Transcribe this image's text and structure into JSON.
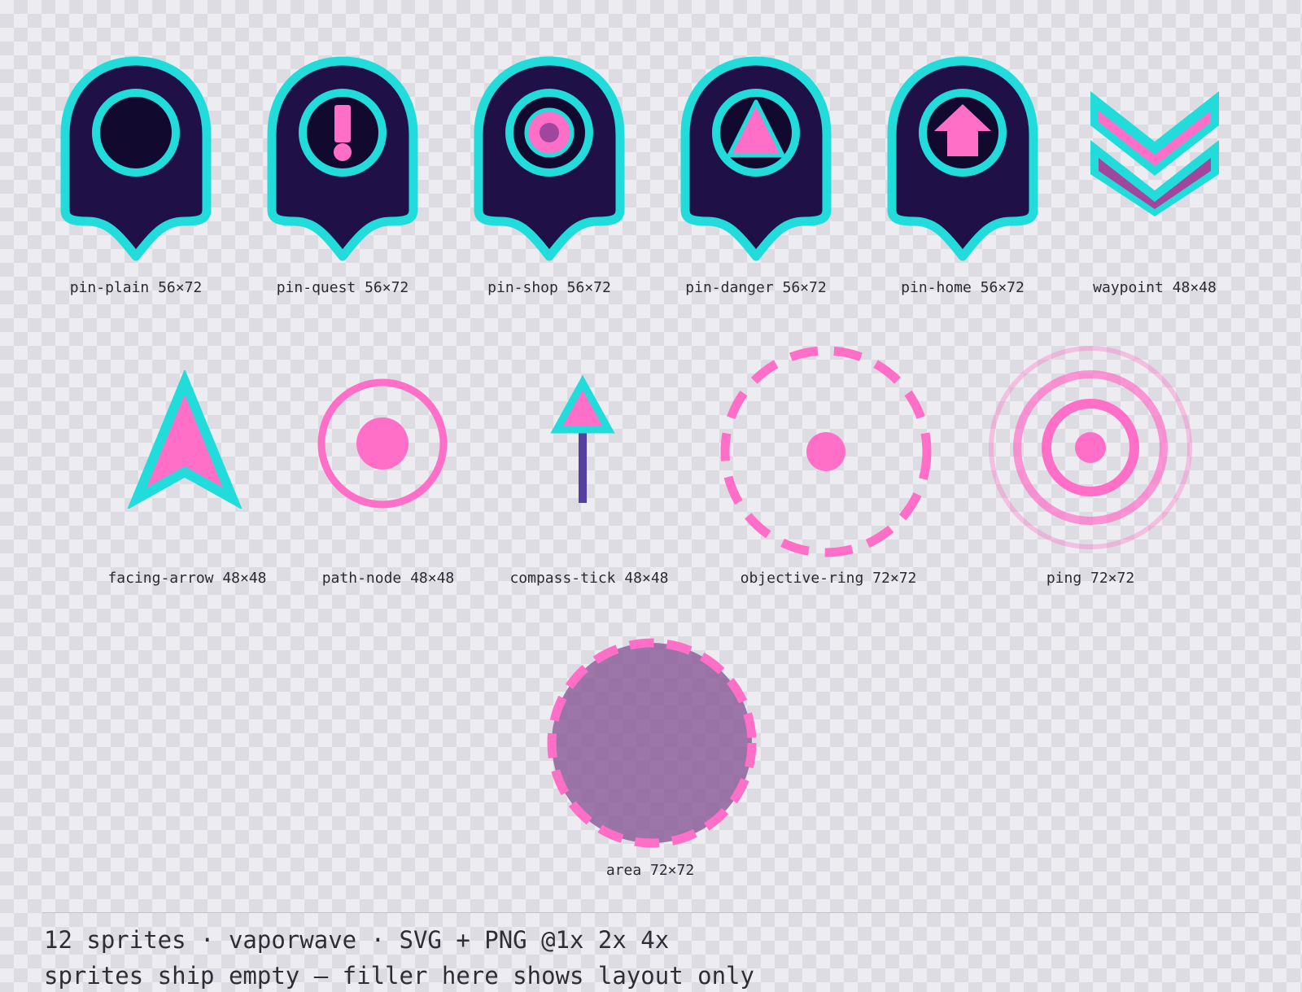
{
  "colors": {
    "outline": "#22dcdc",
    "pin_fill": "#1f1147",
    "pin_inner": "#120a2e",
    "accent": "#ff6ec7",
    "purple": "#a0469c",
    "stem": "#5540a0",
    "area_fill": "#8a5a99"
  },
  "sprites": [
    {
      "label": "pin-plain 56×72",
      "icon": "pin-plain-icon"
    },
    {
      "label": "pin-quest 56×72",
      "icon": "pin-quest-icon"
    },
    {
      "label": "pin-shop 56×72",
      "icon": "pin-shop-icon"
    },
    {
      "label": "pin-danger 56×72",
      "icon": "pin-danger-icon"
    },
    {
      "label": "pin-home 56×72",
      "icon": "pin-home-icon"
    },
    {
      "label": "waypoint 48×48",
      "icon": "waypoint-icon"
    },
    {
      "label": "facing-arrow 48×48",
      "icon": "facing-arrow-icon"
    },
    {
      "label": "path-node 48×48",
      "icon": "path-node-icon"
    },
    {
      "label": "compass-tick 48×48",
      "icon": "compass-tick-icon"
    },
    {
      "label": "objective-ring 72×72",
      "icon": "objective-ring-icon"
    },
    {
      "label": "ping 72×72",
      "icon": "ping-icon"
    },
    {
      "label": "area 72×72",
      "icon": "area-icon"
    }
  ],
  "footer": {
    "line1": "12 sprites · vaporwave · SVG + PNG @1x 2x 4x",
    "line2": "sprites ship empty — filler here shows layout only"
  }
}
